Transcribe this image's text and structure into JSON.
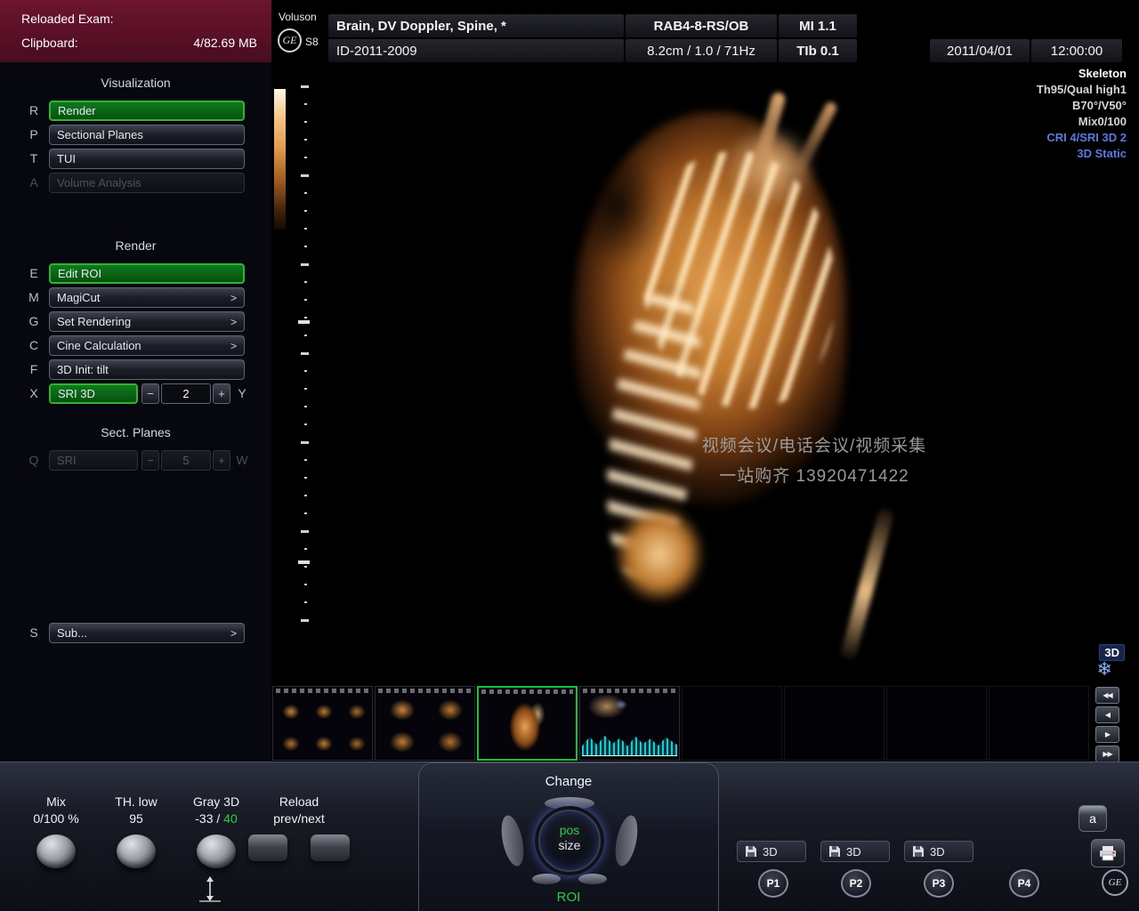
{
  "colors": {
    "active_green_border": "#33b233",
    "value_green": "#2ecc44",
    "overlay_blue": "#5b79e0",
    "render_amber": "#d98f44",
    "clipboard_red": "#6e1430"
  },
  "clipboard": {
    "title": "Reloaded Exam:",
    "label": "Clipboard:",
    "size": "4/82.69 MB"
  },
  "sidebar": {
    "chevron": ">",
    "minus": "−",
    "plus": "+",
    "visualization": {
      "title": "Visualization",
      "rows": [
        {
          "key": "R",
          "label": "Render"
        },
        {
          "key": "P",
          "label": "Sectional Planes"
        },
        {
          "key": "T",
          "label": "TUI"
        },
        {
          "key": "A",
          "label": "Volume Analysis"
        }
      ]
    },
    "render": {
      "title": "Render",
      "rows": [
        {
          "key": "E",
          "label": "Edit ROI"
        },
        {
          "key": "M",
          "label": "MagiCut"
        },
        {
          "key": "G",
          "label": "Set Rendering"
        },
        {
          "key": "C",
          "label": "Cine Calculation"
        },
        {
          "key": "F",
          "label": "3D Init: tilt"
        },
        {
          "key": "X",
          "label": "SRI 3D"
        }
      ],
      "sri_value": "2",
      "sri_key_right": "Y"
    },
    "sect_planes": {
      "title": "Sect. Planes",
      "row": {
        "key": "Q",
        "label": "SRI",
        "value": "5",
        "key_right": "W"
      }
    },
    "sub_row": {
      "key": "S",
      "label": "Sub..."
    }
  },
  "header": {
    "brand": {
      "name": "Voluson",
      "model": "S8",
      "logo": "GE"
    },
    "preset": "Brain, DV Doppler, Spine,  *",
    "probe": "RAB4-8-RS/OB",
    "mi": "MI  1.1",
    "patient_id": "ID-2011-2009",
    "acq_params": "8.2cm / 1.0 / 71Hz",
    "tib": "TIb  0.1",
    "date": "2011/04/01",
    "time": "12:00:00"
  },
  "image_overlay": {
    "lines": [
      "Skeleton",
      "Th95/Qual high1",
      "B70°/V50°",
      "Mix0/100",
      "CRI 4/SRI 3D 2",
      "3D  Static"
    ],
    "watermark_line1": "视频会议/电话会议/视频采集",
    "watermark_line2": "一站购齐 13920471422",
    "badge_3d": "3D",
    "snowflake_icon": "❄"
  },
  "cine_nav": {
    "rewind": "◀◀",
    "prev": "◀",
    "next": "▶",
    "forward": "▶▶"
  },
  "bottom": {
    "mix": {
      "label": "Mix",
      "value": "0/100 %"
    },
    "th_low": {
      "label": "TH. low",
      "value": "95"
    },
    "gray_3d": {
      "label": "Gray 3D",
      "value_prefix": "-33 / ",
      "value_highlight": "40"
    },
    "reload": {
      "label": "Reload",
      "value": "prev/next"
    },
    "console": {
      "title": "Change",
      "trackball_top": "pos",
      "trackball_bottom": "size",
      "footer": "ROI"
    },
    "save_buttons": [
      {
        "label": "3D"
      },
      {
        "label": "3D"
      },
      {
        "label": "3D"
      }
    ],
    "p_buttons": [
      "P1",
      "P2",
      "P3",
      "P4"
    ],
    "a_key": "a",
    "ge_logo": "GE"
  }
}
